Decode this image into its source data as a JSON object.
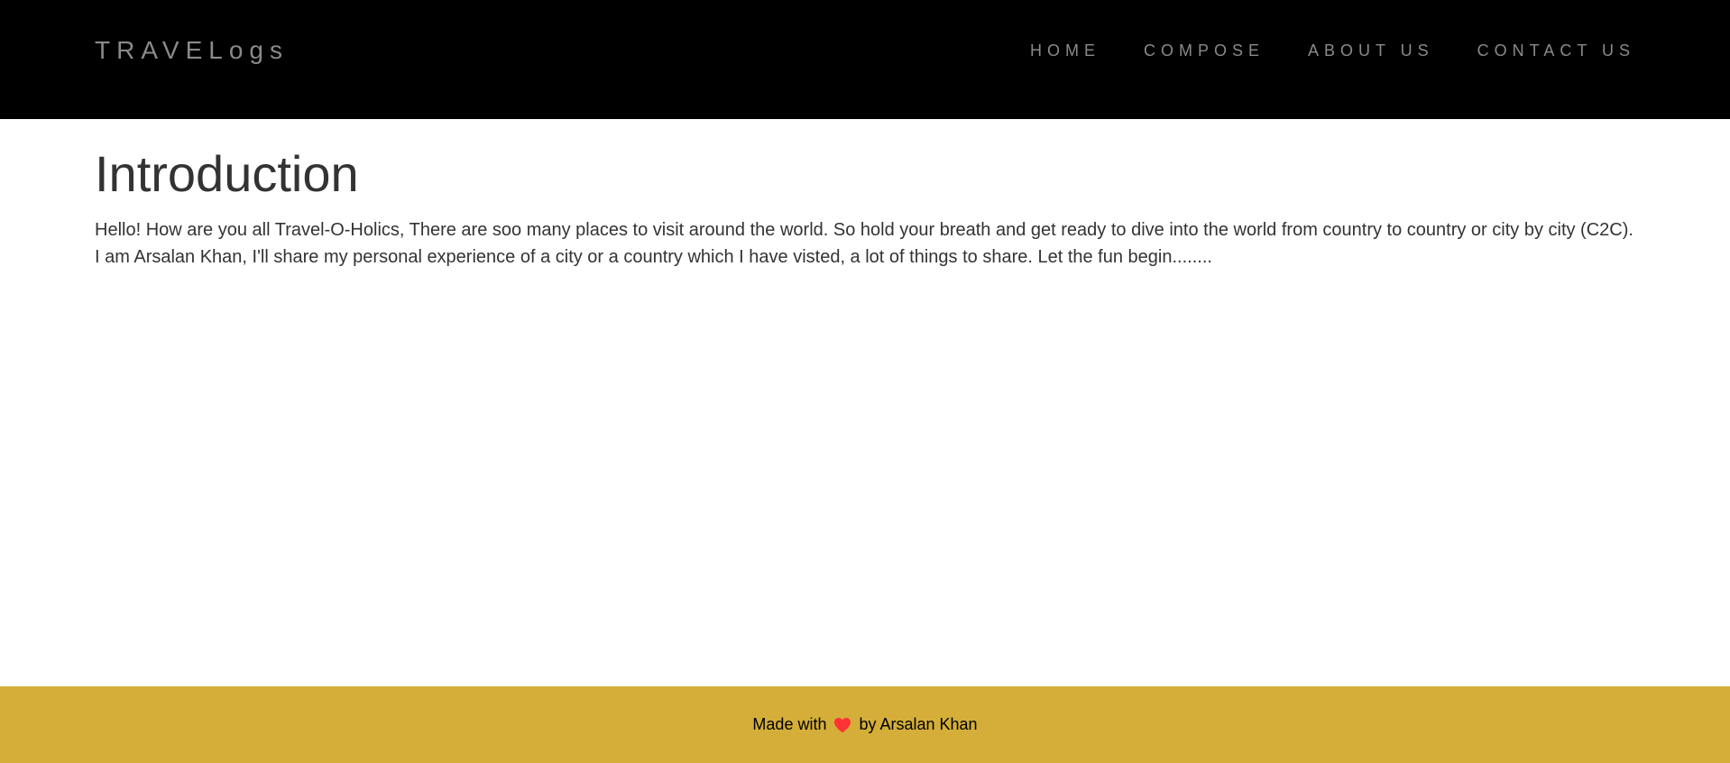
{
  "header": {
    "brand": "TRAVELogs",
    "nav": [
      {
        "label": "HOME"
      },
      {
        "label": "COMPOSE"
      },
      {
        "label": "ABOUT US"
      },
      {
        "label": "CONTACT US"
      }
    ]
  },
  "main": {
    "title": "Introduction",
    "body": "Hello! How are you all Travel-O-Holics, There are soo many places to visit around the world. So hold your breath and get ready to dive into the world from country to country or city by city (C2C). I am Arsalan Khan, I'll share my personal experience of a city or a country which I have visted, a lot of things to share. Let the fun begin........"
  },
  "footer": {
    "prefix": "Made with",
    "icon": "heart-icon",
    "suffix": "by Arsalan Khan"
  },
  "colors": {
    "navbar_bg": "#000000",
    "nav_text": "#8a8a8a",
    "footer_bg": "#d4ae39",
    "heart": "#ff3333",
    "body_text": "#333333"
  }
}
